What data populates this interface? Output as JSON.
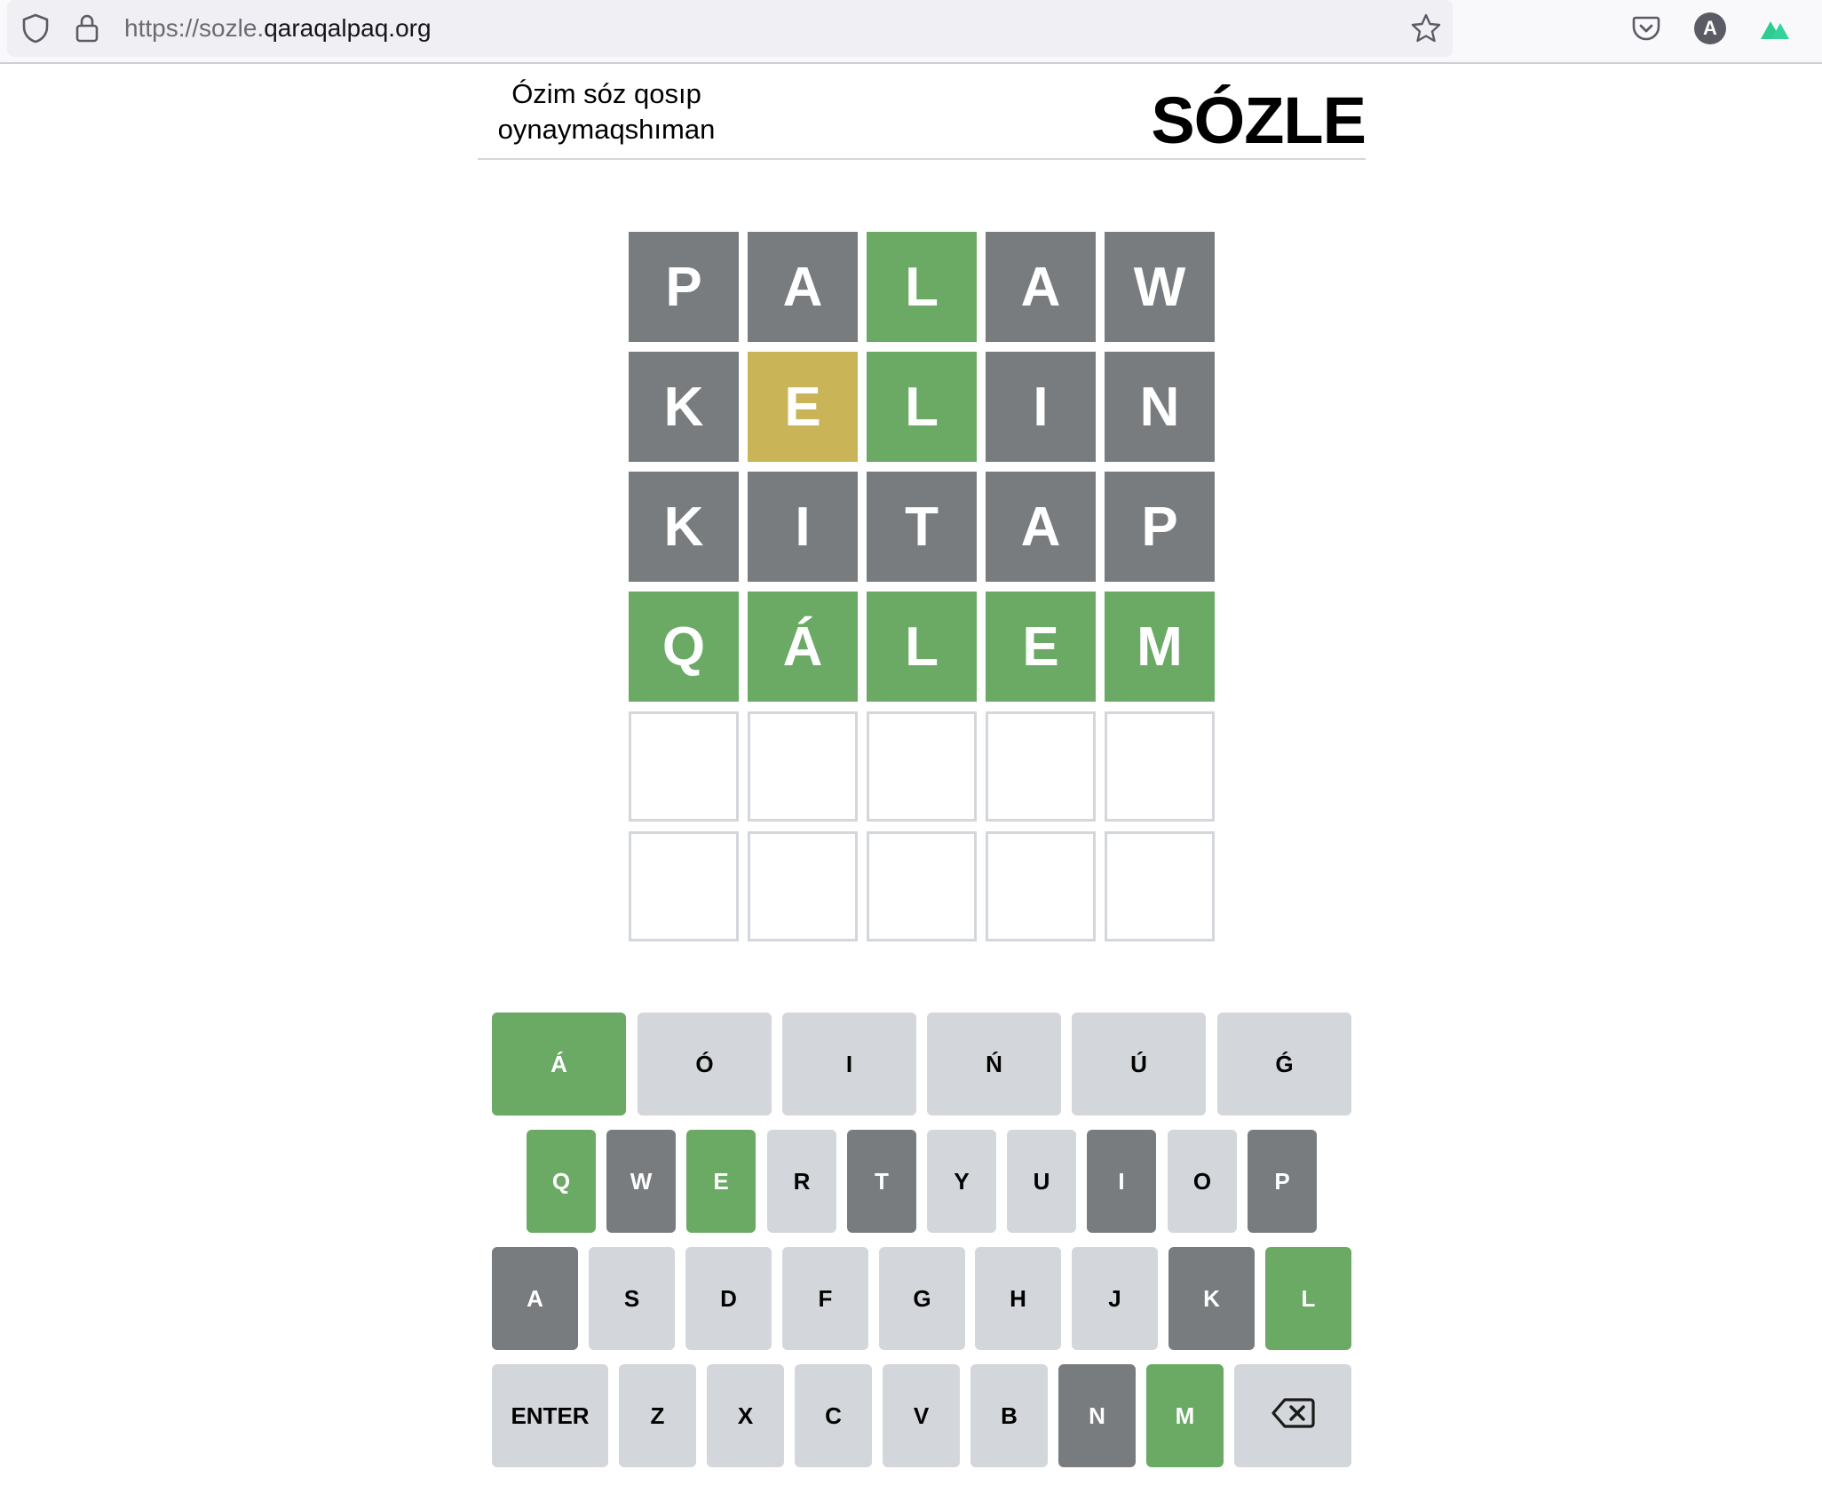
{
  "browser": {
    "url_prefix": "https://sozle.",
    "url_domain": "qaraqalpaq.org",
    "icons": [
      "shield-icon",
      "lock-icon",
      "star-icon",
      "pocket-icon",
      "account-icon",
      "extension-icon"
    ],
    "account_letter": "A"
  },
  "header": {
    "tagline": "Ózim sóz qosıp oynaymaqshıman",
    "logo": "SÓZLE"
  },
  "board": {
    "rows": [
      [
        {
          "letter": "P",
          "state": "absent"
        },
        {
          "letter": "A",
          "state": "absent"
        },
        {
          "letter": "L",
          "state": "correct"
        },
        {
          "letter": "A",
          "state": "absent"
        },
        {
          "letter": "W",
          "state": "absent"
        }
      ],
      [
        {
          "letter": "K",
          "state": "absent"
        },
        {
          "letter": "E",
          "state": "present"
        },
        {
          "letter": "L",
          "state": "correct"
        },
        {
          "letter": "I",
          "state": "absent"
        },
        {
          "letter": "N",
          "state": "absent"
        }
      ],
      [
        {
          "letter": "K",
          "state": "absent"
        },
        {
          "letter": "I",
          "state": "absent"
        },
        {
          "letter": "T",
          "state": "absent"
        },
        {
          "letter": "A",
          "state": "absent"
        },
        {
          "letter": "P",
          "state": "absent"
        }
      ],
      [
        {
          "letter": "Q",
          "state": "correct"
        },
        {
          "letter": "Á",
          "state": "correct"
        },
        {
          "letter": "L",
          "state": "correct"
        },
        {
          "letter": "E",
          "state": "correct"
        },
        {
          "letter": "M",
          "state": "correct"
        }
      ],
      [
        {
          "letter": "",
          "state": "empty"
        },
        {
          "letter": "",
          "state": "empty"
        },
        {
          "letter": "",
          "state": "empty"
        },
        {
          "letter": "",
          "state": "empty"
        },
        {
          "letter": "",
          "state": "empty"
        }
      ],
      [
        {
          "letter": "",
          "state": "empty"
        },
        {
          "letter": "",
          "state": "empty"
        },
        {
          "letter": "",
          "state": "empty"
        },
        {
          "letter": "",
          "state": "empty"
        },
        {
          "letter": "",
          "state": "empty"
        }
      ]
    ]
  },
  "keyboard": {
    "rows": [
      [
        {
          "label": "Á",
          "state": "correct"
        },
        {
          "label": "Ó",
          "state": "unused"
        },
        {
          "label": "I",
          "state": "unused"
        },
        {
          "label": "Ń",
          "state": "unused"
        },
        {
          "label": "Ú",
          "state": "unused"
        },
        {
          "label": "Ǵ",
          "state": "unused"
        }
      ],
      [
        {
          "label": "Q",
          "state": "correct"
        },
        {
          "label": "W",
          "state": "absent"
        },
        {
          "label": "E",
          "state": "correct"
        },
        {
          "label": "R",
          "state": "unused"
        },
        {
          "label": "T",
          "state": "absent"
        },
        {
          "label": "Y",
          "state": "unused"
        },
        {
          "label": "U",
          "state": "unused"
        },
        {
          "label": "I",
          "state": "absent"
        },
        {
          "label": "O",
          "state": "unused"
        },
        {
          "label": "P",
          "state": "absent"
        }
      ],
      [
        {
          "label": "A",
          "state": "absent"
        },
        {
          "label": "S",
          "state": "unused"
        },
        {
          "label": "D",
          "state": "unused"
        },
        {
          "label": "F",
          "state": "unused"
        },
        {
          "label": "G",
          "state": "unused"
        },
        {
          "label": "H",
          "state": "unused"
        },
        {
          "label": "J",
          "state": "unused"
        },
        {
          "label": "K",
          "state": "absent"
        },
        {
          "label": "L",
          "state": "correct"
        }
      ],
      [
        {
          "label": "ENTER",
          "state": "unused"
        },
        {
          "label": "Z",
          "state": "unused"
        },
        {
          "label": "X",
          "state": "unused"
        },
        {
          "label": "C",
          "state": "unused"
        },
        {
          "label": "V",
          "state": "unused"
        },
        {
          "label": "B",
          "state": "unused"
        },
        {
          "label": "N",
          "state": "absent"
        },
        {
          "label": "M",
          "state": "correct"
        },
        {
          "label": "",
          "icon": "backspace-icon",
          "state": "unused"
        }
      ]
    ]
  },
  "colors": {
    "correct": "#6aaa64",
    "present": "#c9b458",
    "absent": "#787c7e",
    "unused_key": "#d3d6da",
    "empty_border": "#d3d6da"
  }
}
